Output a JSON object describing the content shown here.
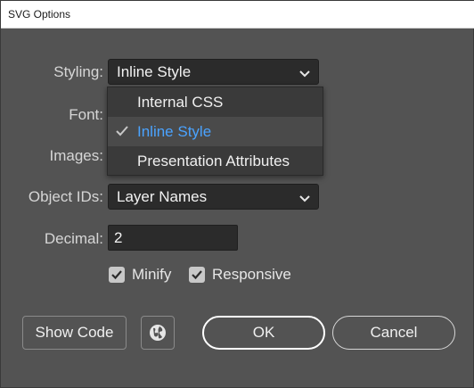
{
  "window": {
    "title": "SVG Options"
  },
  "labels": {
    "styling": "Styling:",
    "font": "Font:",
    "images": "Images:",
    "object_ids": "Object IDs:",
    "decimal": "Decimal:"
  },
  "styling": {
    "selected": "Inline Style",
    "options": [
      "Internal CSS",
      "Inline Style",
      "Presentation Attributes"
    ],
    "checked_index": 1
  },
  "object_ids": {
    "selected": "Layer Names"
  },
  "decimal": {
    "value": "2"
  },
  "checkboxes": {
    "minify": {
      "label": "Minify",
      "checked": true
    },
    "responsive": {
      "label": "Responsive",
      "checked": true
    }
  },
  "buttons": {
    "show_code": "Show Code",
    "ok": "OK",
    "cancel": "Cancel"
  },
  "colors": {
    "background": "#535353",
    "field": "#2b2b2b",
    "accent": "#4aa3ff"
  },
  "icons": {
    "chevron": "chevron-down-icon",
    "globe": "globe-icon",
    "check": "checkmark-icon"
  }
}
